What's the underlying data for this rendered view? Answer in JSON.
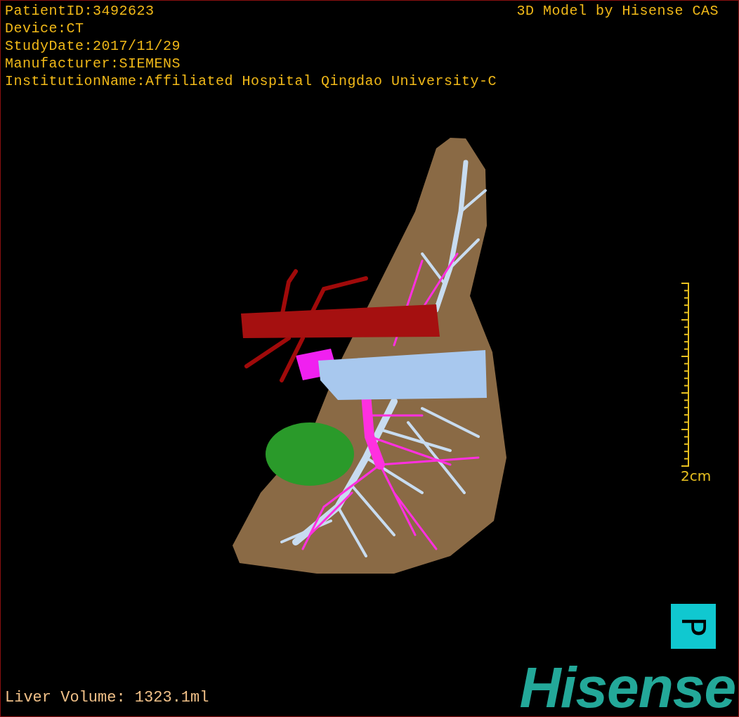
{
  "info_lines": [
    "PatientID:3492623",
    "Device:CT",
    "StudyDate:2017/11/29",
    "Manufacturer:SIEMENS",
    "InstitutionName:Affiliated Hospital Qingdao University-C"
  ],
  "model_title": "3D Model by Hisense CAS",
  "scale_bar": {
    "label": "2cm"
  },
  "orientation_marker": {
    "label": "P"
  },
  "liver_volume": "Liver Volume: 1323.1ml",
  "logo": {
    "text": "Hisense"
  }
}
